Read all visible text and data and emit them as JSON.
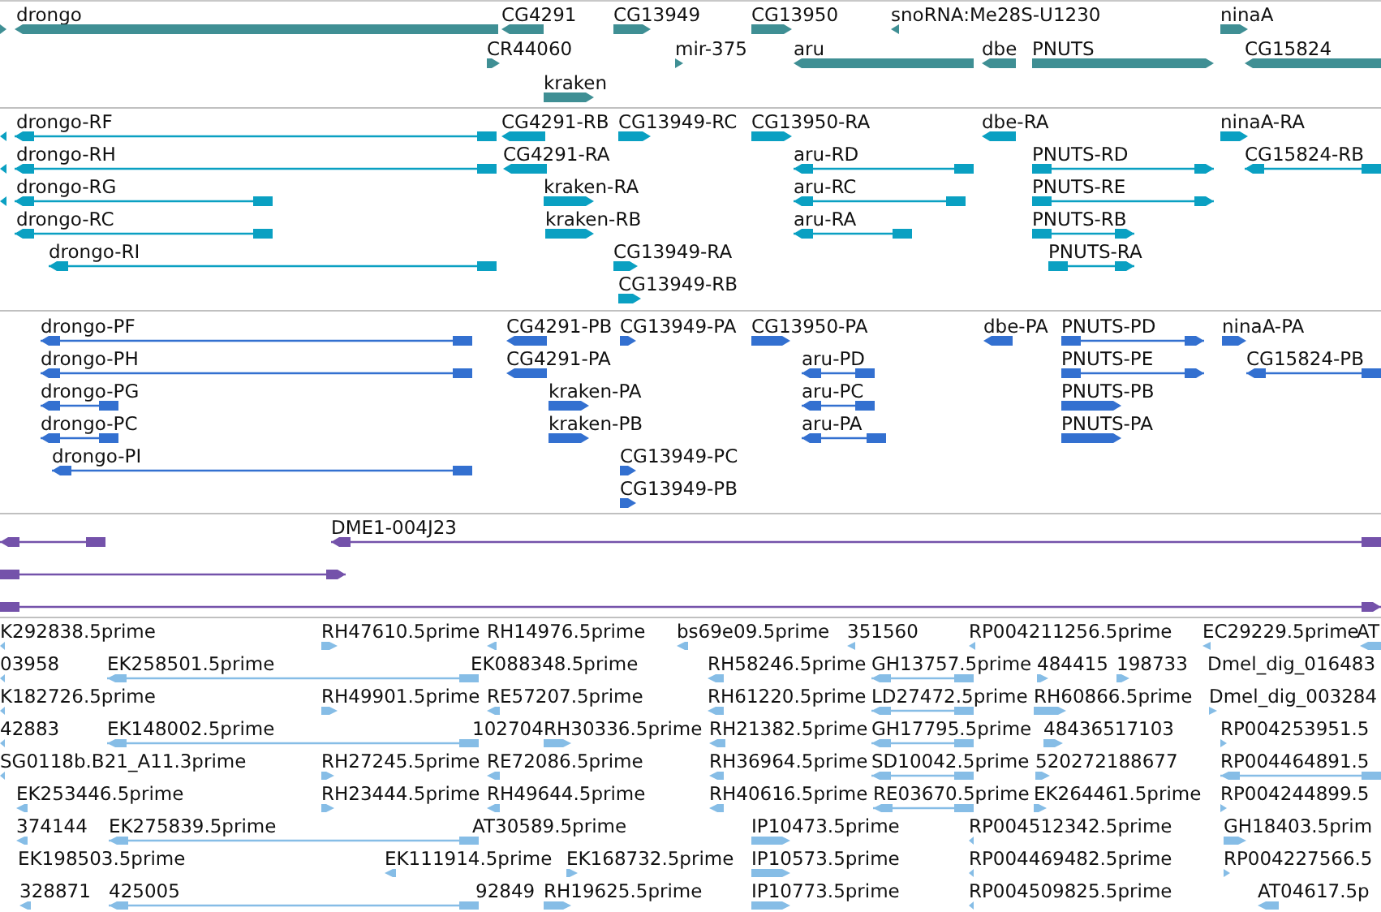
{
  "tracks": [
    {
      "kind": "gene",
      "lanes": [
        {
          "features": [
            {
              "reverse": false
            },
            {
              "label": "drongo",
              "reverse": true
            },
            {
              "label": "CG4291",
              "reverse": true
            },
            {
              "label": "CG13949",
              "reverse": false
            },
            {
              "label": "CG13950",
              "reverse": false
            },
            {
              "label": "snoRNA:Me28S-U1230",
              "reverse": true
            },
            {
              "label": "ninaA",
              "reverse": false
            }
          ]
        },
        {
          "features": [
            {
              "label": "CR44060",
              "reverse": false
            },
            {
              "label": "mir-375",
              "reverse": false
            },
            {
              "label": "aru",
              "reverse": true
            },
            {
              "label": "dbe",
              "reverse": true
            },
            {
              "label": "PNUTS",
              "reverse": false
            },
            {
              "label": "CG15824",
              "reverse": true
            }
          ]
        },
        {
          "features": [
            {
              "label": "kraken",
              "reverse": false
            }
          ]
        }
      ]
    },
    {
      "kind": "transcript",
      "lanes": [
        {
          "features": [
            {
              "reverse": true
            },
            {
              "label": "drongo-RF",
              "reverse": true
            },
            {
              "label": "CG4291-RB",
              "reverse": true
            },
            {
              "label": "CG13949-RC",
              "reverse": false
            },
            {
              "label": "CG13950-RA",
              "reverse": false
            },
            {
              "label": "dbe-RA",
              "reverse": true
            },
            {
              "label": "ninaA-RA",
              "reverse": false
            }
          ]
        },
        {
          "features": [
            {
              "reverse": true
            },
            {
              "label": "drongo-RH",
              "reverse": true
            },
            {
              "label": "CG4291-RA",
              "reverse": true
            },
            {
              "label": "aru-RD",
              "reverse": true
            },
            {
              "label": "PNUTS-RD",
              "reverse": false
            },
            {
              "label": "CG15824-RB",
              "reverse": true
            }
          ]
        },
        {
          "features": [
            {
              "reverse": true
            },
            {
              "label": "drongo-RG",
              "reverse": true
            },
            {
              "label": "kraken-RA",
              "reverse": false
            },
            {
              "label": "aru-RC",
              "reverse": true
            },
            {
              "label": "PNUTS-RE",
              "reverse": false
            }
          ]
        },
        {
          "features": [
            {
              "label": "drongo-RC",
              "reverse": true
            },
            {
              "label": "kraken-RB",
              "reverse": false
            },
            {
              "label": "aru-RA",
              "reverse": true
            },
            {
              "label": "PNUTS-RB",
              "reverse": false
            }
          ]
        },
        {
          "features": [
            {
              "label": "drongo-RI",
              "reverse": true
            },
            {
              "label": "CG13949-RA",
              "reverse": false
            },
            {
              "label": "PNUTS-RA",
              "reverse": false
            }
          ]
        },
        {
          "features": [
            {
              "label": "CG13949-RB",
              "reverse": false
            }
          ]
        }
      ]
    },
    {
      "kind": "protein",
      "lanes": [
        {
          "features": [
            {
              "label": "drongo-PF",
              "reverse": true
            },
            {
              "label": "CG4291-PB",
              "reverse": true
            },
            {
              "label": "CG13949-PA",
              "reverse": false
            },
            {
              "label": "CG13950-PA",
              "reverse": false
            },
            {
              "label": "dbe-PA",
              "reverse": true
            },
            {
              "label": "PNUTS-PD",
              "reverse": false
            },
            {
              "label": "ninaA-PA",
              "reverse": false
            }
          ]
        },
        {
          "features": [
            {
              "label": "drongo-PH",
              "reverse": true
            },
            {
              "label": "CG4291-PA",
              "reverse": true
            },
            {
              "label": "aru-PD",
              "reverse": true
            },
            {
              "label": "PNUTS-PE",
              "reverse": false
            },
            {
              "label": "CG15824-PB",
              "reverse": true
            }
          ]
        },
        {
          "features": [
            {
              "label": "drongo-PG",
              "reverse": true
            },
            {
              "label": "kraken-PA",
              "reverse": false
            },
            {
              "label": "aru-PC",
              "reverse": true
            },
            {
              "label": "PNUTS-PB",
              "reverse": false
            }
          ]
        },
        {
          "features": [
            {
              "label": "drongo-PC",
              "reverse": true
            },
            {
              "label": "kraken-PB",
              "reverse": false
            },
            {
              "label": "aru-PA",
              "reverse": true
            },
            {
              "label": "PNUTS-PA",
              "reverse": false
            }
          ]
        },
        {
          "features": [
            {
              "label": "drongo-PI",
              "reverse": true
            },
            {
              "label": "CG13949-PC",
              "reverse": false
            }
          ]
        },
        {
          "features": [
            {
              "label": "CG13949-PB",
              "reverse": false
            }
          ]
        }
      ]
    },
    {
      "kind": "clone",
      "lanes": [
        {
          "features": [
            {
              "reverse": true
            },
            {
              "label": "DME1-004J23",
              "reverse": true
            }
          ]
        },
        {
          "features": [
            {
              "reverse": false
            }
          ]
        },
        {
          "features": [
            {
              "reverse": false
            }
          ]
        }
      ]
    },
    {
      "kind": "est",
      "lanes": [
        {
          "features": [
            {
              "label": "K292838.5prime",
              "reverse": true
            },
            {
              "label": "RH47610.5prime",
              "reverse": false
            },
            {
              "label": "RH14976.5prime",
              "reverse": true
            },
            {
              "label": "bs69e09.5prime",
              "reverse": true
            },
            {
              "label": "351560",
              "reverse": true
            },
            {
              "label": "RP004211256.5prime",
              "reverse": true
            },
            {
              "label": "EC29229.5prime",
              "reverse": true
            },
            {
              "label": "AT",
              "reverse": true
            }
          ]
        },
        {
          "features": [
            {
              "label": "03958",
              "reverse": true
            },
            {
              "label": "EK258501.5prime",
              "reverse": true
            },
            {
              "label": "EK088348.5prime"
            },
            {
              "label": "RH58246.5prime",
              "reverse": true
            },
            {
              "label": "GH13757.5prime",
              "reverse": true
            },
            {
              "label": "484415",
              "reverse": false
            },
            {
              "label": "198733",
              "reverse": false
            },
            {
              "label": "Dmel_dig_016483"
            }
          ]
        },
        {
          "features": [
            {
              "label": "K182726.5prime",
              "reverse": true
            },
            {
              "label": "RH49901.5prime",
              "reverse": false
            },
            {
              "label": "RE57207.5prime",
              "reverse": true
            },
            {
              "label": "RH61220.5prime",
              "reverse": true
            },
            {
              "label": "LD27472.5prime",
              "reverse": true
            },
            {
              "label": "RH60866.5prime",
              "reverse": false
            },
            {
              "label": "Dmel_dig_003284",
              "reverse": false
            }
          ]
        },
        {
          "features": [
            {
              "label": "42883",
              "reverse": true
            },
            {
              "label": "EK148002.5prime",
              "reverse": true
            },
            {
              "label": "102704"
            },
            {
              "label": "RH30336.5prime",
              "reverse": false
            },
            {
              "label": "RH21382.5prime",
              "reverse": true
            },
            {
              "label": "GH17795.5prime",
              "reverse": true
            },
            {
              "label": "48436517103",
              "reverse": false
            },
            {
              "label": "RP004253951.5",
              "reverse": false
            }
          ]
        },
        {
          "features": [
            {
              "label": "SG0118b.B21_A11.3prime",
              "reverse": true
            },
            {
              "label": "RH27245.5prime",
              "reverse": false
            },
            {
              "label": "RE72086.5prime",
              "reverse": true
            },
            {
              "label": "RH36964.5prime",
              "reverse": true
            },
            {
              "label": "SD10042.5prime",
              "reverse": true
            },
            {
              "label": "520272188677",
              "reverse": false
            },
            {
              "label": "RP004464891.5",
              "reverse": true
            }
          ]
        },
        {
          "features": [
            {
              "label": "EK253446.5prime",
              "reverse": true
            },
            {
              "label": "RH23444.5prime",
              "reverse": false
            },
            {
              "label": "RH49644.5prime",
              "reverse": true
            },
            {
              "label": "RH40616.5prime",
              "reverse": true
            },
            {
              "label": "RE03670.5prime",
              "reverse": true
            },
            {
              "label": "EK264461.5prime",
              "reverse": false
            },
            {
              "label": "RP004244899.5",
              "reverse": false
            }
          ]
        },
        {
          "features": [
            {
              "label": "374144",
              "reverse": true
            },
            {
              "label": "EK275839.5prime",
              "reverse": true
            },
            {
              "label": "AT30589.5prime"
            },
            {
              "label": "IP10473.5prime",
              "reverse": false
            },
            {
              "label": "RP004512342.5prime",
              "reverse": true
            },
            {
              "label": "GH18403.5prim",
              "reverse": false
            }
          ]
        },
        {
          "features": [
            {
              "label": "EK198503.5prime"
            },
            {
              "label": "EK111914.5prime",
              "reverse": true
            },
            {
              "label": "EK168732.5prime",
              "reverse": false
            },
            {
              "label": "IP10573.5prime",
              "reverse": false
            },
            {
              "label": "RP004469482.5prime",
              "reverse": true
            },
            {
              "label": "RP004227566.5",
              "reverse": false
            }
          ]
        },
        {
          "features": [
            {
              "label": "328871",
              "reverse": true
            },
            {
              "label": "425005",
              "reverse": true
            },
            {
              "label": "92849"
            },
            {
              "label": "RH19625.5prime",
              "reverse": false
            },
            {
              "label": "IP10773.5prime",
              "reverse": false
            },
            {
              "label": "RP004509825.5prime",
              "reverse": true
            },
            {
              "label": "AT04617.5p",
              "reverse": true
            }
          ]
        }
      ]
    }
  ]
}
